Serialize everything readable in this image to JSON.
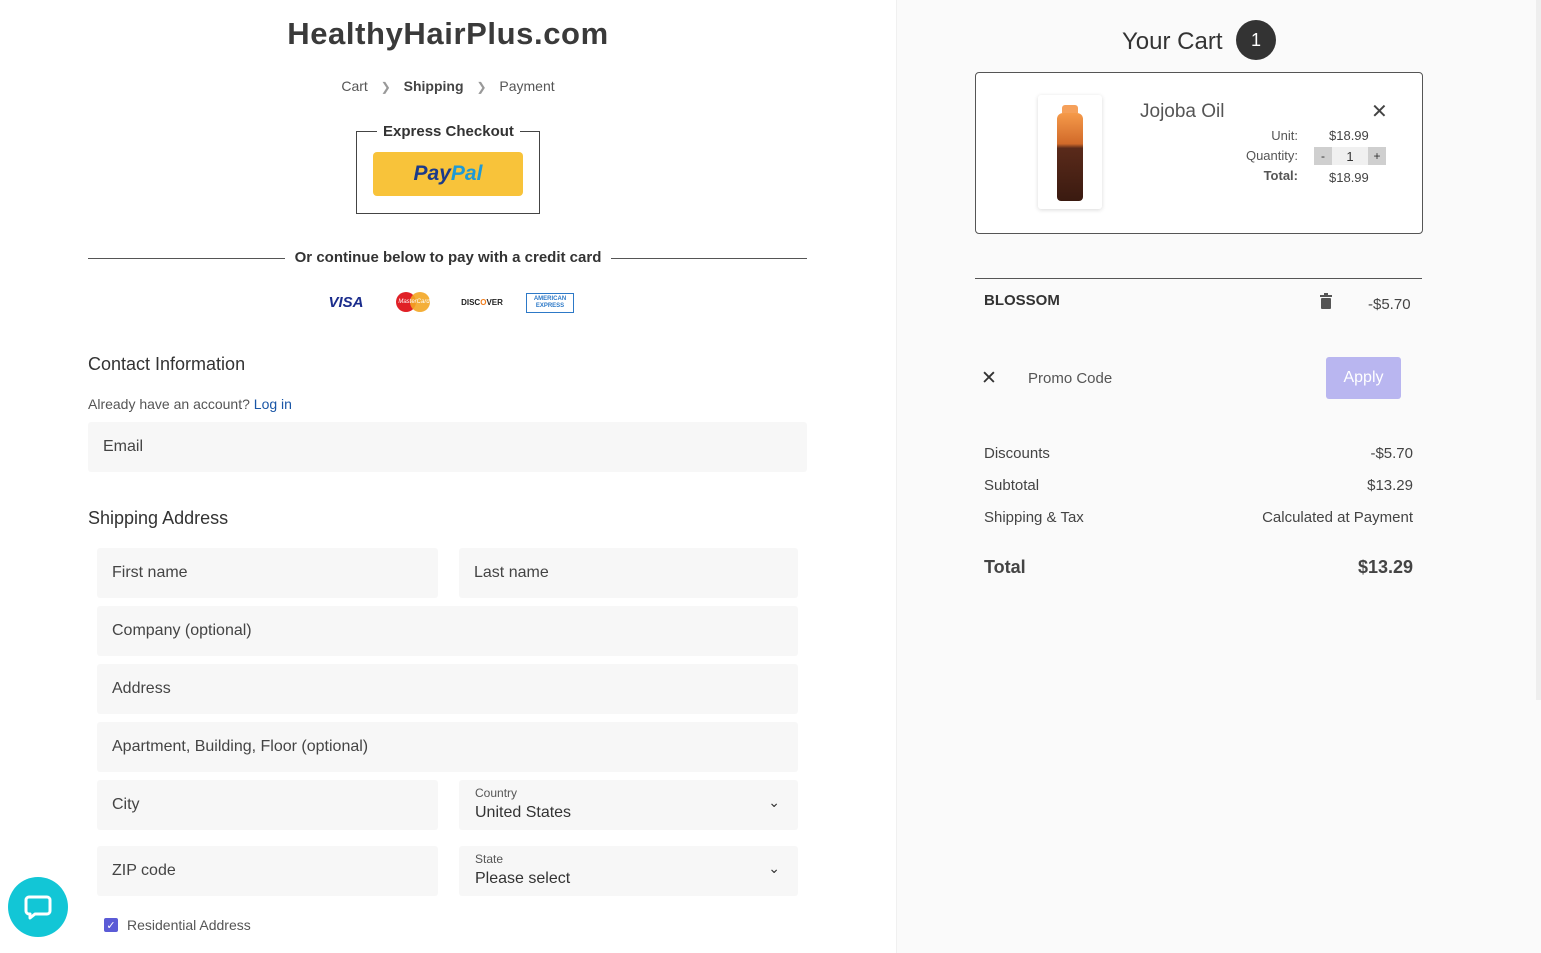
{
  "brand": "HealthyHairPlus.com",
  "breadcrumb": {
    "cart": "Cart",
    "shipping": "Shipping",
    "payment": "Payment"
  },
  "express": {
    "label": "Express Checkout",
    "paypal_a": "Pay",
    "paypal_b": "Pal"
  },
  "divider_text": "Or continue below to pay with a credit card",
  "cards": {
    "visa": "VISA",
    "mastercard": "MasterCard",
    "discover_a": "DISC",
    "discover_o": "O",
    "discover_b": "VER",
    "amex": "AMERICAN EXPRESS"
  },
  "contact": {
    "title": "Contact Information",
    "account_q": "Already have an account?",
    "login": "Log in",
    "email_placeholder": "Email"
  },
  "shipping": {
    "title": "Shipping Address",
    "first_name": "First name",
    "last_name": "Last name",
    "company": "Company (optional)",
    "address": "Address",
    "apartment": "Apartment, Building, Floor (optional)",
    "city": "City",
    "country_label": "Country",
    "country_value": "United States",
    "zip": "ZIP code",
    "state_label": "State",
    "state_value": "Please select",
    "residential": "Residential Address"
  },
  "cart": {
    "title": "Your Cart",
    "count": "1",
    "item": {
      "name": "Jojoba Oil",
      "unit_label": "Unit:",
      "unit_value": "$18.99",
      "quantity_label": "Quantity:",
      "quantity": "1",
      "total_label": "Total:",
      "total_value": "$18.99"
    },
    "promo": {
      "code": "BLOSSOM",
      "amount": "-$5.70",
      "placeholder": "Promo Code",
      "apply": "Apply"
    },
    "summary": {
      "discounts_label": "Discounts",
      "discounts_value": "-$5.70",
      "subtotal_label": "Subtotal",
      "subtotal_value": "$13.29",
      "shipping_label": "Shipping & Tax",
      "shipping_value": "Calculated at Payment",
      "total_label": "Total",
      "total_value": "$13.29"
    }
  },
  "colors": {
    "apply": "#b9b6f0",
    "paypal": "#f8c33a",
    "chat": "#12c6d6",
    "link": "#1a56a6"
  }
}
